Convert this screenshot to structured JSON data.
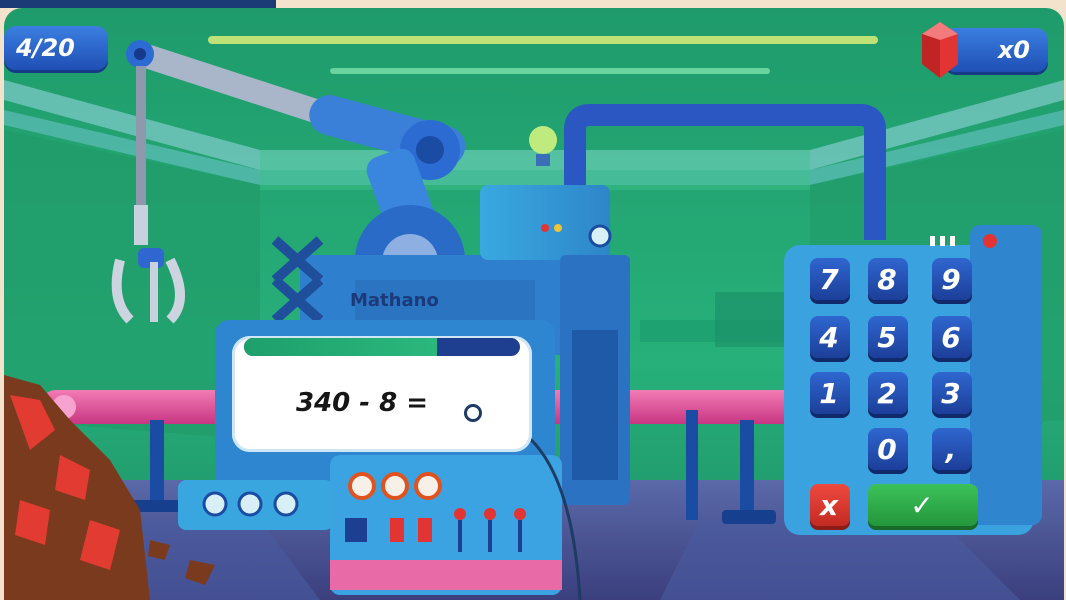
{
  "hud": {
    "progress": "4/20",
    "gems": "x0"
  },
  "machine": {
    "brand": "Mathano"
  },
  "question": {
    "text": "340 - 8 =",
    "timer_fraction": 0.7
  },
  "keypad": {
    "keys": [
      "7",
      "8",
      "9",
      "4",
      "5",
      "6",
      "1",
      "2",
      "3",
      "0",
      ","
    ],
    "clear_symbol": "x",
    "confirm_symbol": "✓"
  },
  "colors": {
    "background": "#22a873",
    "accent_blue": "#2f66cf",
    "clear_red": "#e23b31",
    "confirm_green": "#2fae4a",
    "gem_red": "#e33434"
  }
}
